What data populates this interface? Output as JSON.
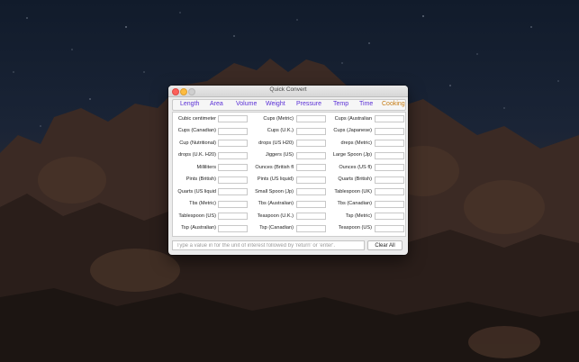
{
  "window": {
    "title": "Quick Convert"
  },
  "tabs": [
    {
      "label": "Length",
      "active": false
    },
    {
      "label": "Area",
      "active": false
    },
    {
      "label": "Volume",
      "active": false
    },
    {
      "label": "Weight",
      "active": false
    },
    {
      "label": "Pressure",
      "active": false
    },
    {
      "label": "Temp",
      "active": false
    },
    {
      "label": "Time",
      "active": false
    },
    {
      "label": "Cooking",
      "active": true
    }
  ],
  "units": [
    [
      "Cubic centimeter",
      "Cups (Metric)",
      "Cups (Australian"
    ],
    [
      "Cups (Canadian)",
      "Cups (U.K.)",
      "Cups (Japanese)"
    ],
    [
      "Cup (Nutritional)",
      "drops (US H20)",
      "dreps (Metric)"
    ],
    [
      "drops (U.K. H20)",
      "Jiggers (US)",
      "Large Spoon (Jp)"
    ],
    [
      "Milliliters",
      "Ounces (British fl",
      "Ounces (US fl)"
    ],
    [
      "Pints (British)",
      "Pints (US liquid)",
      "Quarts (British)"
    ],
    [
      "Quarts (US liquid",
      "Small Spoon (Jp)",
      "Tablespoon (UK)"
    ],
    [
      "Tbs (Metric)",
      "Tbs (Australian)",
      "Tbs (Canadian)"
    ],
    [
      "Tablespoon (US)",
      "Teaspoon (U.K.)",
      "Tsp (Metric)"
    ],
    [
      "Tsp (Australian)",
      "Tsp (Canadian)",
      "Teaspoon (US)"
    ]
  ],
  "input": {
    "placeholder": "Type a value in for the unit of interest followed by 'return' or 'enter'.",
    "value": ""
  },
  "buttons": {
    "clear_all": "Clear All"
  },
  "colors": {
    "tab_text": "#5a2fd6",
    "tab_active": "#c57a12",
    "close": "#fc605b",
    "minimize": "#fdbc40"
  }
}
